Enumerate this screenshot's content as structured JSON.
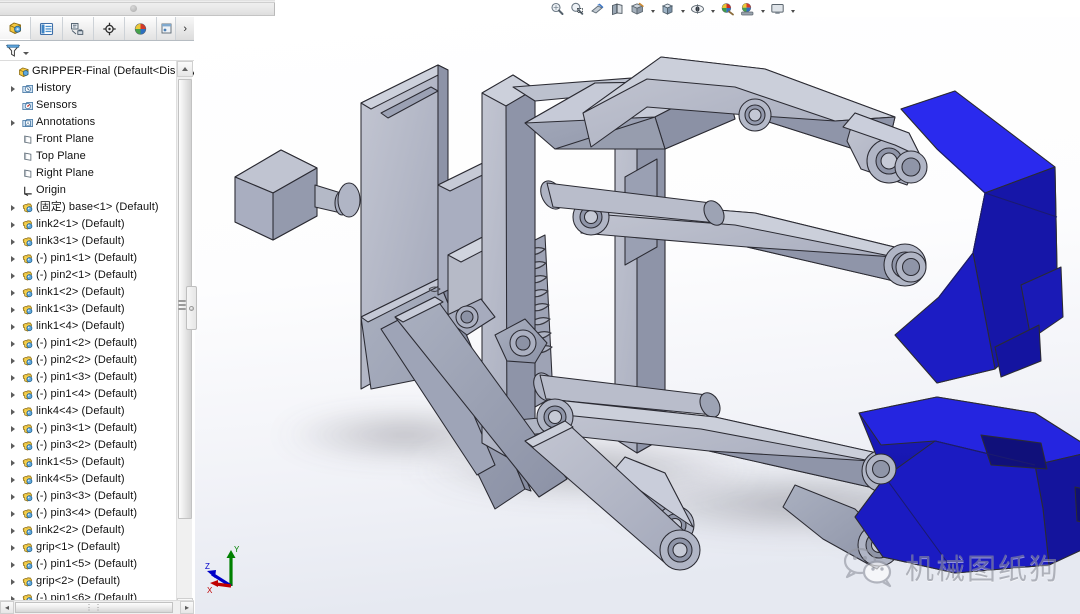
{
  "app": {
    "title": "GRIPPER-Final",
    "document_name": "GRIPPER-Final  (Default<Display S"
  },
  "feature_manager": {
    "tabs": [
      {
        "name": "feature-manager-design-tree",
        "icon": "assembly-tree-icon",
        "active": true
      },
      {
        "name": "property-manager",
        "icon": "property-list-icon",
        "active": false
      },
      {
        "name": "configuration-manager",
        "icon": "configuration-icon",
        "active": false
      },
      {
        "name": "dimxpert-manager",
        "icon": "dimxpert-target-icon",
        "active": false
      },
      {
        "name": "display-manager",
        "icon": "color-wheel-icon",
        "active": false
      },
      {
        "name": "extra-tab",
        "icon": "panel-icon",
        "active": false
      }
    ],
    "nav_arrow": "›",
    "filter": {
      "icon": "filter-funnel-icon",
      "placeholder": ""
    },
    "tree": [
      {
        "label": "GRIPPER-Final  (Default<Display S",
        "icon": "assembly-icon",
        "arrow": false,
        "indent": 0,
        "root": true
      },
      {
        "label": "History",
        "icon": "history-icon",
        "arrow": true,
        "indent": 1
      },
      {
        "label": "Sensors",
        "icon": "sensors-icon",
        "arrow": false,
        "indent": 1
      },
      {
        "label": "Annotations",
        "icon": "annotations-icon",
        "arrow": true,
        "indent": 1
      },
      {
        "label": "Front Plane",
        "icon": "plane-icon",
        "arrow": false,
        "indent": 1
      },
      {
        "label": "Top Plane",
        "icon": "plane-icon",
        "arrow": false,
        "indent": 1
      },
      {
        "label": "Right Plane",
        "icon": "plane-icon",
        "arrow": false,
        "indent": 1
      },
      {
        "label": "Origin",
        "icon": "origin-icon",
        "arrow": false,
        "indent": 1
      },
      {
        "label": "(固定) base<1> (Default)",
        "icon": "component-icon",
        "arrow": true,
        "indent": 1
      },
      {
        "label": "link2<1> (Default)",
        "icon": "component-icon",
        "arrow": true,
        "indent": 1
      },
      {
        "label": "link3<1> (Default)",
        "icon": "component-icon",
        "arrow": true,
        "indent": 1
      },
      {
        "label": "(-) pin1<1> (Default)",
        "icon": "component-icon",
        "arrow": true,
        "indent": 1
      },
      {
        "label": "(-) pin2<1> (Default)",
        "icon": "component-icon",
        "arrow": true,
        "indent": 1
      },
      {
        "label": "link1<2> (Default)",
        "icon": "component-icon",
        "arrow": true,
        "indent": 1
      },
      {
        "label": "link1<3> (Default)",
        "icon": "component-icon",
        "arrow": true,
        "indent": 1
      },
      {
        "label": "link1<4> (Default)",
        "icon": "component-icon",
        "arrow": true,
        "indent": 1
      },
      {
        "label": "(-) pin1<2> (Default)",
        "icon": "component-icon",
        "arrow": true,
        "indent": 1
      },
      {
        "label": "(-) pin2<2> (Default)",
        "icon": "component-icon",
        "arrow": true,
        "indent": 1
      },
      {
        "label": "(-) pin1<3> (Default)",
        "icon": "component-icon",
        "arrow": true,
        "indent": 1
      },
      {
        "label": "(-) pin1<4> (Default)",
        "icon": "component-icon",
        "arrow": true,
        "indent": 1
      },
      {
        "label": "link4<4> (Default)",
        "icon": "component-icon",
        "arrow": true,
        "indent": 1
      },
      {
        "label": "(-) pin3<1> (Default)",
        "icon": "component-icon",
        "arrow": true,
        "indent": 1
      },
      {
        "label": "(-) pin3<2> (Default)",
        "icon": "component-icon",
        "arrow": true,
        "indent": 1
      },
      {
        "label": "link1<5> (Default)",
        "icon": "component-icon",
        "arrow": true,
        "indent": 1
      },
      {
        "label": "link4<5> (Default)",
        "icon": "component-icon",
        "arrow": true,
        "indent": 1
      },
      {
        "label": "(-) pin3<3> (Default)",
        "icon": "component-icon",
        "arrow": true,
        "indent": 1
      },
      {
        "label": "(-) pin3<4> (Default)",
        "icon": "component-icon",
        "arrow": true,
        "indent": 1
      },
      {
        "label": "link2<2> (Default)",
        "icon": "component-icon",
        "arrow": true,
        "indent": 1
      },
      {
        "label": "grip<1> (Default)",
        "icon": "component-icon",
        "arrow": true,
        "indent": 1
      },
      {
        "label": "(-) pin1<5> (Default)",
        "icon": "component-icon",
        "arrow": true,
        "indent": 1
      },
      {
        "label": "grip<2> (Default)",
        "icon": "component-icon",
        "arrow": true,
        "indent": 1
      },
      {
        "label": "(-) pin1<6> (Default)",
        "icon": "component-icon",
        "arrow": true,
        "indent": 1
      }
    ],
    "scroll": {
      "vertical_grip": "≡",
      "horizontal_grip": "⋮⋮"
    }
  },
  "heads_up_toolbar": [
    {
      "name": "zoom-to-fit-button",
      "icon": "magnifier-fit-icon",
      "caret": false
    },
    {
      "name": "zoom-to-area-button",
      "icon": "magnifier-area-icon",
      "caret": false
    },
    {
      "name": "previous-view-button",
      "icon": "previous-view-icon",
      "caret": false
    },
    {
      "name": "section-view-button",
      "icon": "section-view-icon",
      "caret": false
    },
    {
      "name": "view-orientation-button",
      "icon": "view-orientation-icon",
      "caret": false
    },
    {
      "name": "display-style-button",
      "icon": "display-style-icon",
      "caret": true
    },
    {
      "name": "hide-show-items-button",
      "icon": "hide-show-cube-icon",
      "caret": true
    },
    {
      "name": "edit-appearance-button",
      "icon": "appearance-sphere-icon",
      "caret": true
    },
    {
      "name": "apply-scene-button",
      "icon": "scene-ball-icon",
      "caret": false
    },
    {
      "name": "view-settings-button",
      "icon": "view-settings-ball-icon",
      "caret": true
    },
    {
      "name": "viewport-button",
      "icon": "monitor-icon",
      "caret": true
    }
  ],
  "graphics": {
    "triad": {
      "axes": [
        {
          "label": "Y",
          "color": "#008000"
        },
        {
          "label": "Z",
          "color": "#0000c8"
        },
        {
          "label": "X",
          "color": "#c00000"
        }
      ]
    },
    "watermark": {
      "text": "机械图纸狗",
      "icon": "wechat-logo-icon"
    },
    "model": {
      "name": "robotic-gripper-assembly",
      "colors": {
        "steel_light": "#b9bcc9",
        "steel_mid": "#9ba0b2",
        "steel_dark": "#7e8497",
        "steel_darker": "#6b7184",
        "blue_jaw": "#1a1ac8",
        "blue_jaw_light": "#2828e2",
        "blue_jaw_dark": "#10107f",
        "edge": "#2a2a30",
        "background_top": "#ffffff",
        "background_bottom": "#e9ebf2",
        "shadow": "#6e6e74"
      },
      "parts": [
        "base",
        "motor-block",
        "lead-screw",
        "slider-block",
        "link1",
        "link2",
        "link3",
        "link4",
        "pin1",
        "pin2",
        "pin3",
        "grip-upper",
        "grip-lower"
      ]
    }
  }
}
